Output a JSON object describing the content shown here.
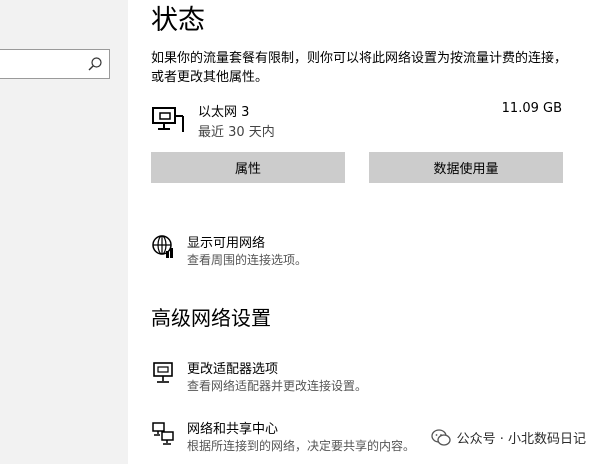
{
  "search": {
    "placeholder": ""
  },
  "main": {
    "title": "状态",
    "description": "如果你的流量套餐有限制，则你可以将此网络设置为按流量计费的连接，或者更改其他属性。",
    "network": {
      "name": "以太网 3",
      "period": "最近 30 天内",
      "usage": "11.09 GB"
    },
    "buttons": {
      "properties": "属性",
      "data_usage": "数据使用量"
    },
    "show_networks": {
      "title": "显示可用网络",
      "subtitle": "查看周围的连接选项。"
    },
    "advanced_heading": "高级网络设置",
    "adapter_options": {
      "title": "更改适配器选项",
      "subtitle": "查看网络适配器并更改连接设置。"
    },
    "sharing_center": {
      "title": "网络和共享中心",
      "subtitle": "根据所连接到的网络，决定要共享的内容。"
    }
  },
  "watermark": {
    "text": "公众号 · 小北数码日记"
  },
  "icons": {
    "search": "search-icon",
    "ethernet": "ethernet-pc-icon",
    "globe": "globe-network-icon",
    "adapter": "adapter-monitor-icon",
    "sharing": "sharing-center-icon",
    "wechat": "wechat-icon"
  }
}
